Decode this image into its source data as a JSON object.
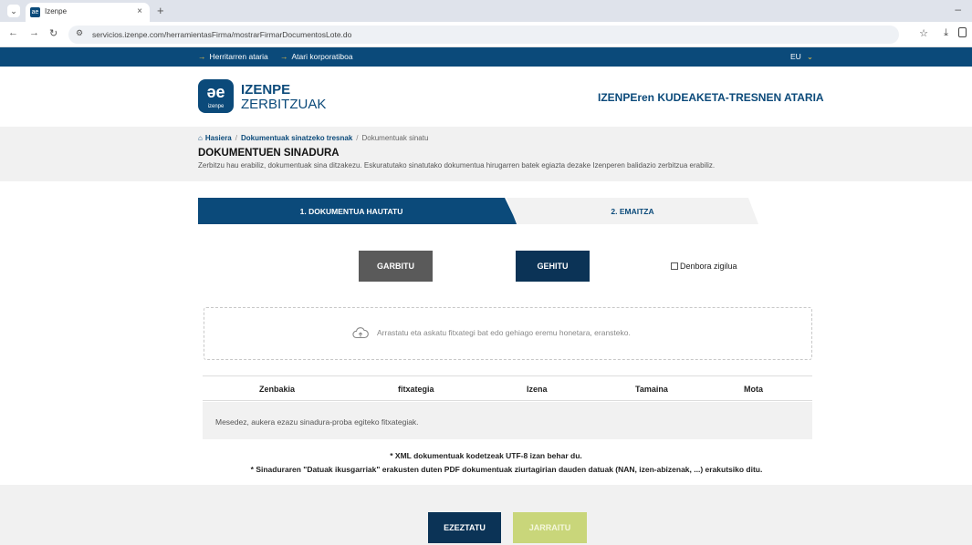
{
  "browser": {
    "tab_title": "Izenpe",
    "tab_close": "×",
    "new_tab": "+",
    "url": "servicios.izenpe.com/herramientasFirma/mostrarFirmarDocumentosLote.do"
  },
  "topbar": {
    "link1": "Herritarren ataria",
    "link2": "Atari korporatiboa",
    "language": "EU"
  },
  "header": {
    "logo_mark": "əe",
    "logo_sub": "izenpe",
    "brand_line1": "IZENPE",
    "brand_line2": "ZERBITZUAK",
    "portal_title": "IZENPEren KUDEAKETA-TRESNEN ATARIA"
  },
  "breadcrumb": {
    "home": "Hasiera",
    "level2": "Dokumentuak sinatzeko tresnak",
    "current": "Dokumentuak sinatu"
  },
  "page": {
    "title": "DOKUMENTUEN SINADURA",
    "description": "Zerbitzu hau erabiliz, dokumentuak sina ditzakezu. Eskuratutako sinatutako dokumentua hirugarren batek egiazta dezake Izenperen balidazio zerbitzua erabiliz."
  },
  "steps": [
    {
      "label": "1. DOKUMENTUA HAUTATU",
      "active": true
    },
    {
      "label": "2. EMAITZA",
      "active": false
    }
  ],
  "actions": {
    "clear_label": "GARBITU",
    "add_label": "GEHITU",
    "timestamp_label": "Denbora zigilua",
    "timestamp_checked": false
  },
  "dropzone": {
    "text": "Arrastatu eta askatu fitxategi bat edo gehiago eremu honetara, eransteko."
  },
  "table": {
    "columns": [
      "Zenbakia",
      "fitxategia",
      "Izena",
      "Tamaina",
      "Mota"
    ],
    "empty_message": "Mesedez, aukera ezazu sinadura-proba egiteko fitxategiak."
  },
  "notes": {
    "note1": "* XML dokumentuak kodetzeak UTF-8 izan behar du.",
    "note2": "* Sinaduraren \"Datuak ikusgarriak\" erakusten duten PDF dokumentuak ziurtagirian dauden datuak (NAN, izen-abizenak, ...) erakutsiko ditu."
  },
  "footer": {
    "cancel_label": "EZEZTATU",
    "next_label": "JARRAITU"
  },
  "colors": {
    "primary": "#0b4a7a",
    "dark_button": "#0b3356",
    "accent_arrow": "#f5c542",
    "disabled_next": "#c9d67a"
  }
}
